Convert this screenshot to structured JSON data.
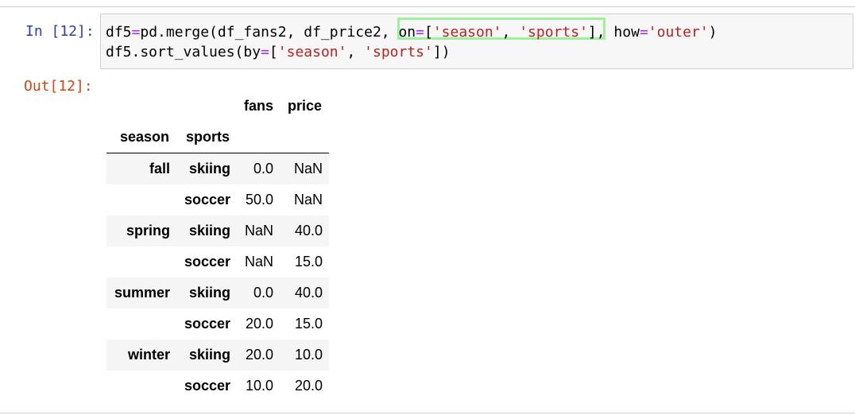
{
  "cell": {
    "in_prompt": "In [12]:",
    "out_prompt": "Out[12]:",
    "code": {
      "line1": [
        {
          "t": "df5",
          "c": ""
        },
        {
          "t": "=",
          "c": "op"
        },
        {
          "t": "pd.merge(df_fans2, df_price2, on",
          "c": ""
        },
        {
          "t": "=",
          "c": "op"
        },
        {
          "t": "[",
          "c": ""
        },
        {
          "t": "'season'",
          "c": "str"
        },
        {
          "t": ", ",
          "c": ""
        },
        {
          "t": "'sports'",
          "c": "str"
        },
        {
          "t": "], how",
          "c": ""
        },
        {
          "t": "=",
          "c": "op"
        },
        {
          "t": "'outer'",
          "c": "str"
        },
        {
          "t": ")",
          "c": ""
        }
      ],
      "line2": [
        {
          "t": "df5.sort_values(by",
          "c": ""
        },
        {
          "t": "=",
          "c": "op"
        },
        {
          "t": "[",
          "c": ""
        },
        {
          "t": "'season'",
          "c": "str"
        },
        {
          "t": ", ",
          "c": ""
        },
        {
          "t": "'sports'",
          "c": "str"
        },
        {
          "t": "])",
          "c": ""
        }
      ]
    },
    "highlight_color": "#9ff09a"
  },
  "dataframe": {
    "columns": [
      "fans",
      "price"
    ],
    "index_names": [
      "season",
      "sports"
    ],
    "rows": [
      {
        "season": "fall",
        "sports": "skiing",
        "fans": "0.0",
        "price": "NaN"
      },
      {
        "season": "",
        "sports": "soccer",
        "fans": "50.0",
        "price": "NaN"
      },
      {
        "season": "spring",
        "sports": "skiing",
        "fans": "NaN",
        "price": "40.0"
      },
      {
        "season": "",
        "sports": "soccer",
        "fans": "NaN",
        "price": "15.0"
      },
      {
        "season": "summer",
        "sports": "skiing",
        "fans": "0.0",
        "price": "40.0"
      },
      {
        "season": "",
        "sports": "soccer",
        "fans": "20.0",
        "price": "15.0"
      },
      {
        "season": "winter",
        "sports": "skiing",
        "fans": "20.0",
        "price": "10.0"
      },
      {
        "season": "",
        "sports": "soccer",
        "fans": "10.0",
        "price": "20.0"
      }
    ]
  },
  "colors": {
    "in_prompt": "#303f9f",
    "out_prompt": "#d84315",
    "string": "#ba2121",
    "operator": "#aa22ff",
    "row_stripe": "#f5f5f5"
  }
}
